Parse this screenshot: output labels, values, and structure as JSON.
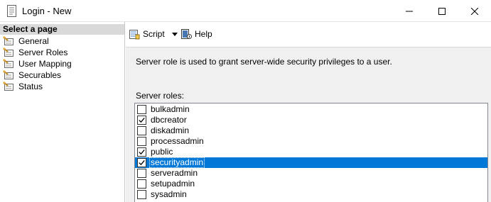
{
  "window": {
    "title": "Login - New",
    "icon": "document-icon"
  },
  "left_pane": {
    "header": "Select a page",
    "items": [
      {
        "label": "General",
        "icon": "wrench-page-icon"
      },
      {
        "label": "Server Roles",
        "icon": "wrench-page-icon"
      },
      {
        "label": "User Mapping",
        "icon": "wrench-page-icon"
      },
      {
        "label": "Securables",
        "icon": "wrench-page-icon"
      },
      {
        "label": "Status",
        "icon": "wrench-page-icon"
      }
    ]
  },
  "toolbar": {
    "script_label": "Script",
    "help_label": "Help"
  },
  "main": {
    "description": "Server role is used to grant server-wide security privileges to a user.",
    "roles_label": "Server roles:",
    "roles": [
      {
        "name": "bulkadmin",
        "checked": false,
        "selected": false
      },
      {
        "name": "dbcreator",
        "checked": true,
        "selected": false
      },
      {
        "name": "diskadmin",
        "checked": false,
        "selected": false
      },
      {
        "name": "processadmin",
        "checked": false,
        "selected": false
      },
      {
        "name": "public",
        "checked": true,
        "selected": false
      },
      {
        "name": "securityadmin",
        "checked": true,
        "selected": true
      },
      {
        "name": "serveradmin",
        "checked": false,
        "selected": false
      },
      {
        "name": "setupadmin",
        "checked": false,
        "selected": false
      },
      {
        "name": "sysadmin",
        "checked": false,
        "selected": false
      }
    ]
  },
  "colors": {
    "selection": "#0078d7",
    "header_bg": "#d9d9d9",
    "pane_bg": "#f0f0f0"
  }
}
